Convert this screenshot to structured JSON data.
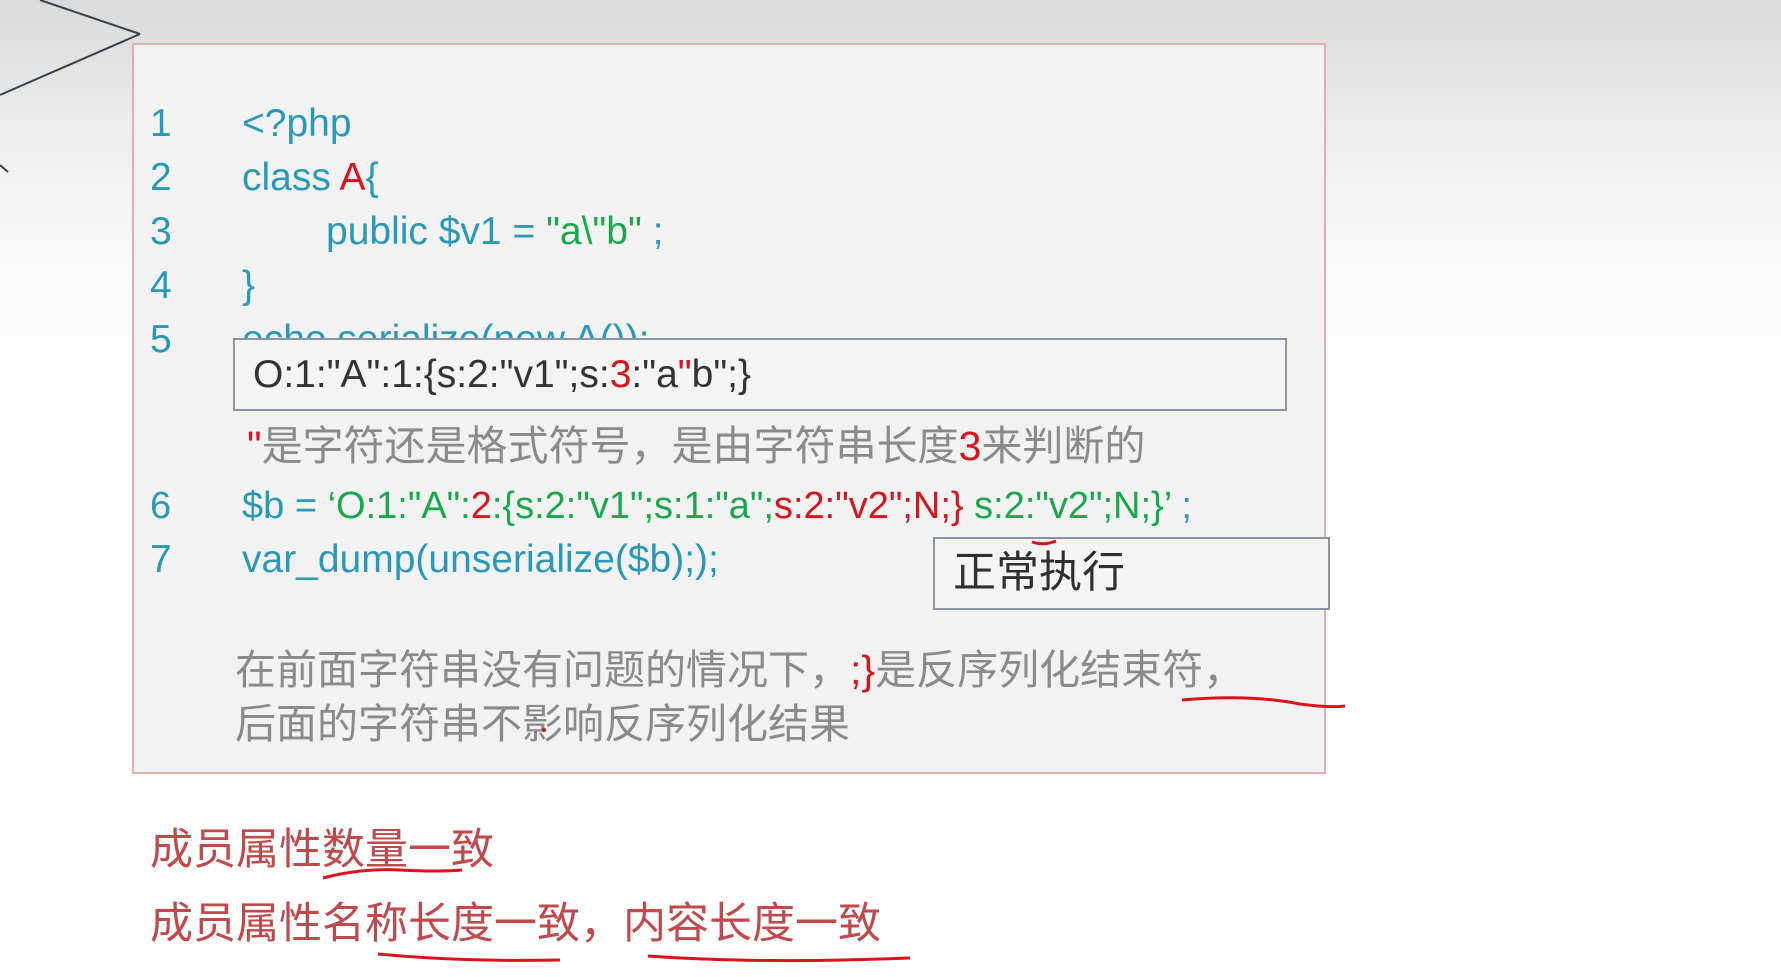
{
  "code_lines": [
    {
      "num": "1",
      "text": "<?php"
    },
    {
      "num": "2",
      "kw": "class ",
      "name": "A",
      "brace": "{"
    },
    {
      "num": "3",
      "prefix": "public $v1 = ",
      "str": "\"a\\\"b\"",
      "suffix": " ;"
    },
    {
      "num": "4",
      "text": "}"
    },
    {
      "num": "5",
      "text": "echo serialize(new A());"
    },
    {
      "num": "6",
      "prefix": "$b = ",
      "p1": "‘O:1:\"A\":",
      "p2": "2",
      "p3": ":{s:2:\"v1\";s:1:\"a\";",
      "p4": "s:2:\"v2\";N;}",
      "p5": " s:2:\"v2\";N;}’",
      "p6": " ;"
    },
    {
      "num": "7",
      "text": "var_dump(unserialize($b););"
    }
  ],
  "output": {
    "part1": "O:1:\"A\":1:{s:2:\"v1\";s:",
    "num": "3",
    "part2": ":\"a",
    "quote": "\"",
    "part3": "b\";}"
  },
  "note1": {
    "quote": "\"",
    "text": "是字符还是格式符号，是由字符串长度",
    "num": "3",
    "tail": "来判断的"
  },
  "result_label": "正常执行",
  "note2": {
    "line1_a": "在前面字符串没有问题的情况下，",
    "line1_b": ";}",
    "line1_c": "是反序列化结束符，",
    "line2": "后面的字符串不影响反序列化结果"
  },
  "bottom_notes": [
    "成员属性数量一致",
    "成员属性名称长度一致，内容长度一致"
  ]
}
